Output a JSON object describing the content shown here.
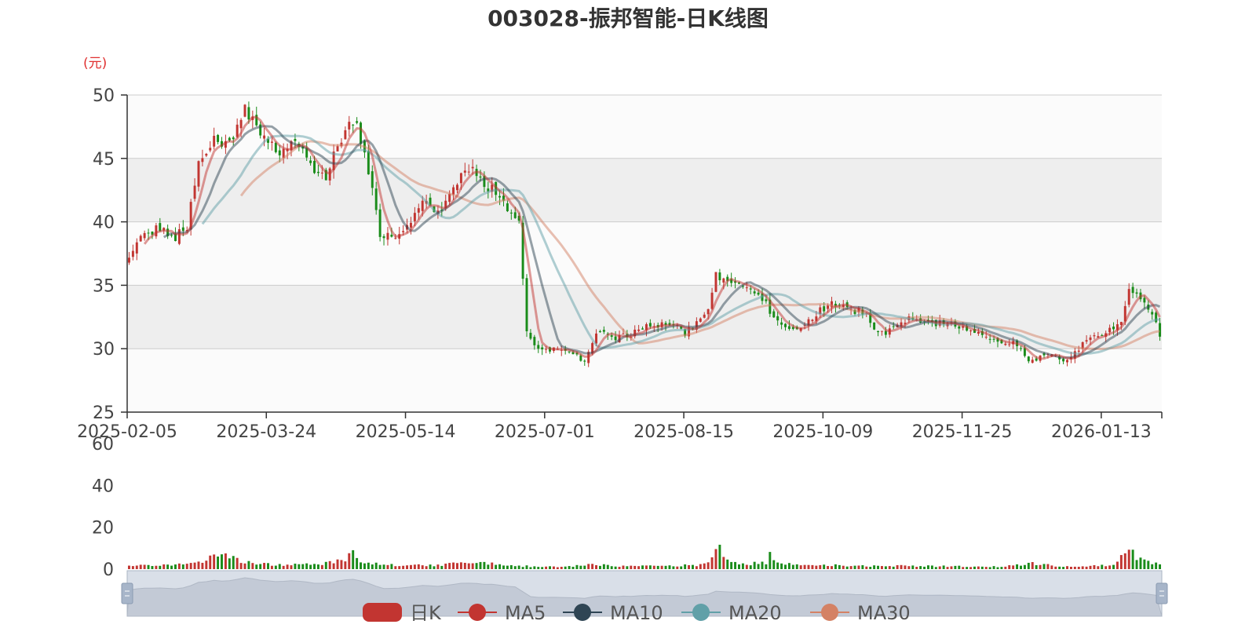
{
  "chart_data": {
    "type": "candlestick",
    "title": "003028-振邦智能-日K线图",
    "y_unit": "(元)",
    "ylim": [
      25,
      50
    ],
    "y_ticks": [
      25,
      30,
      35,
      40,
      45,
      50
    ],
    "x_tick_labels": [
      "2025-02-05",
      "2025-03-24",
      "2025-05-14",
      "2025-07-01",
      "2025-08-15",
      "2025-10-09",
      "2025-11-25",
      "2026-01-13"
    ],
    "volume_ylim": [
      0,
      60
    ],
    "volume_ticks": [
      0,
      20,
      40,
      60
    ],
    "colors": {
      "up": "#c23531",
      "down": "#1a8c1a",
      "ma5": "#c23531",
      "ma10": "#2f4554",
      "ma20": "#61a0a8",
      "ma30": "#d48265"
    },
    "legend": [
      "日K",
      "MA5",
      "MA10",
      "MA20",
      "MA30"
    ],
    "close_anchors": [
      [
        0,
        37.5
      ],
      [
        4,
        39.0
      ],
      [
        8,
        39.5
      ],
      [
        12,
        38.8
      ],
      [
        15,
        39.6
      ],
      [
        18,
        44.5
      ],
      [
        22,
        46.5
      ],
      [
        26,
        46.0
      ],
      [
        30,
        48.8
      ],
      [
        33,
        47.5
      ],
      [
        36,
        46.5
      ],
      [
        39,
        45.0
      ],
      [
        42,
        46.5
      ],
      [
        45,
        45.8
      ],
      [
        48,
        44.0
      ],
      [
        51,
        43.5
      ],
      [
        54,
        46.0
      ],
      [
        57,
        47.5
      ],
      [
        59,
        47.8
      ],
      [
        62,
        44.0
      ],
      [
        65,
        39.0
      ],
      [
        68,
        38.8
      ],
      [
        71,
        39.2
      ],
      [
        74,
        40.5
      ],
      [
        77,
        41.8
      ],
      [
        80,
        40.8
      ],
      [
        83,
        42.0
      ],
      [
        86,
        43.5
      ],
      [
        89,
        44.5
      ],
      [
        92,
        42.8
      ],
      [
        95,
        42.5
      ],
      [
        98,
        41.0
      ],
      [
        101,
        40.2
      ],
      [
        103,
        31.2
      ],
      [
        106,
        30.2
      ],
      [
        109,
        30.0
      ],
      [
        112,
        29.7
      ],
      [
        115,
        29.5
      ],
      [
        118,
        29.2
      ],
      [
        120,
        30.6
      ],
      [
        123,
        31.6
      ],
      [
        126,
        30.9
      ],
      [
        129,
        31.0
      ],
      [
        132,
        31.4
      ],
      [
        135,
        31.8
      ],
      [
        138,
        32.0
      ],
      [
        141,
        31.8
      ],
      [
        144,
        31.2
      ],
      [
        147,
        32.0
      ],
      [
        150,
        33.0
      ],
      [
        152,
        35.8
      ],
      [
        155,
        35.3
      ],
      [
        158,
        35.0
      ],
      [
        161,
        34.8
      ],
      [
        164,
        34.0
      ],
      [
        167,
        32.4
      ],
      [
        170,
        31.8
      ],
      [
        173,
        31.6
      ],
      [
        176,
        32.2
      ],
      [
        179,
        33.0
      ],
      [
        182,
        33.5
      ],
      [
        185,
        33.2
      ],
      [
        188,
        33.0
      ],
      [
        191,
        32.8
      ],
      [
        194,
        31.2
      ],
      [
        197,
        31.4
      ],
      [
        200,
        32.2
      ],
      [
        203,
        32.4
      ],
      [
        206,
        32.0
      ],
      [
        209,
        32.0
      ],
      [
        212,
        32.2
      ],
      [
        215,
        31.8
      ],
      [
        218,
        31.6
      ],
      [
        221,
        31.0
      ],
      [
        224,
        30.6
      ],
      [
        227,
        30.5
      ],
      [
        230,
        30.4
      ],
      [
        233,
        29.0
      ],
      [
        236,
        29.3
      ],
      [
        239,
        29.4
      ],
      [
        242,
        29.2
      ],
      [
        245,
        29.6
      ],
      [
        248,
        30.6
      ],
      [
        251,
        31.0
      ],
      [
        254,
        31.5
      ],
      [
        257,
        32.0
      ],
      [
        259,
        34.5
      ],
      [
        262,
        33.8
      ],
      [
        265,
        32.8
      ],
      [
        267,
        31.0
      ]
    ],
    "volume_anchors": [
      [
        0,
        1.5
      ],
      [
        10,
        2.0
      ],
      [
        18,
        3.5
      ],
      [
        24,
        6.5
      ],
      [
        30,
        3.2
      ],
      [
        38,
        2.0
      ],
      [
        50,
        2.2
      ],
      [
        56,
        5.0
      ],
      [
        58,
        8.0
      ],
      [
        60,
        3.5
      ],
      [
        66,
        2.0
      ],
      [
        80,
        1.8
      ],
      [
        90,
        3.5
      ],
      [
        96,
        2.0
      ],
      [
        105,
        1.2
      ],
      [
        112,
        1.0
      ],
      [
        120,
        2.5
      ],
      [
        125,
        1.5
      ],
      [
        140,
        1.5
      ],
      [
        148,
        2.0
      ],
      [
        151,
        5.5
      ],
      [
        153,
        10.0
      ],
      [
        155,
        4.0
      ],
      [
        160,
        2.5
      ],
      [
        165,
        3.0
      ],
      [
        166,
        6.5
      ],
      [
        170,
        2.5
      ],
      [
        180,
        2.0
      ],
      [
        190,
        1.5
      ],
      [
        200,
        1.5
      ],
      [
        213,
        1.4
      ],
      [
        226,
        1.2
      ],
      [
        234,
        2.8
      ],
      [
        240,
        1.5
      ],
      [
        250,
        1.5
      ],
      [
        255,
        2.0
      ],
      [
        259,
        9.0
      ],
      [
        261,
        5.5
      ],
      [
        267,
        2.0
      ]
    ]
  }
}
